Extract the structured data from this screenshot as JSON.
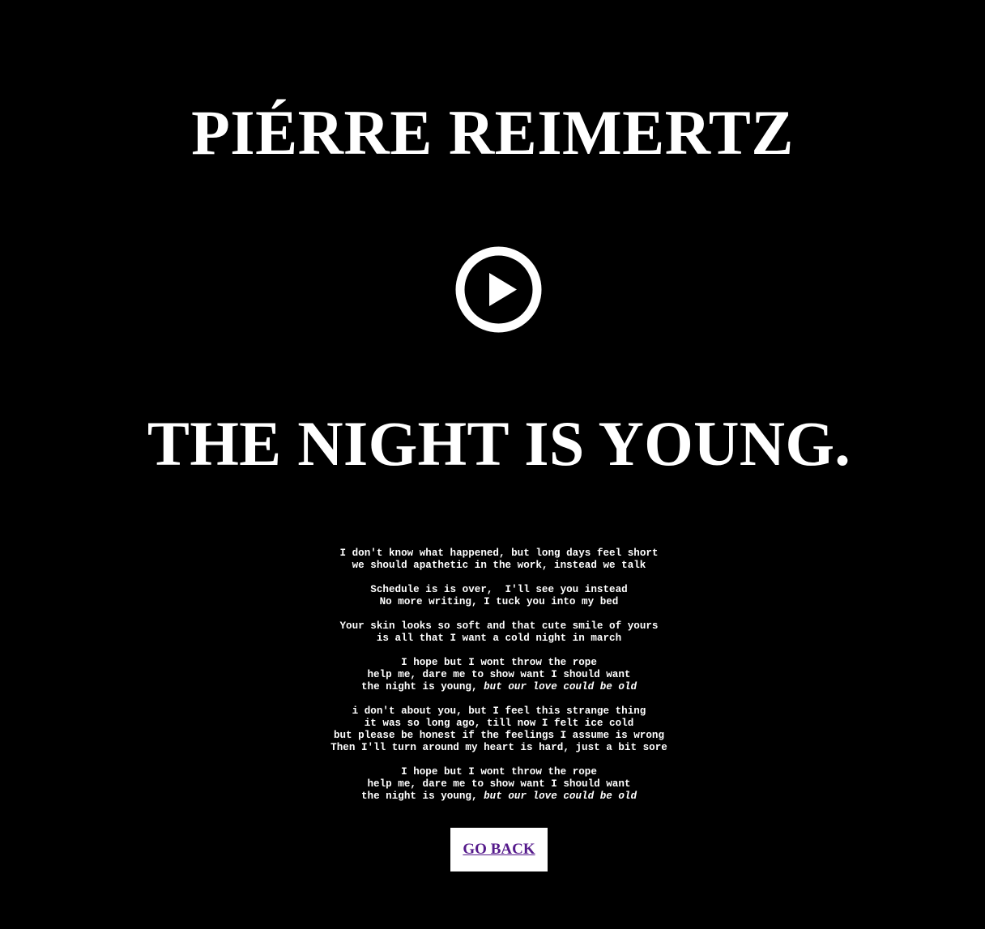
{
  "header": {
    "artist": "PIÉRRE REIMERTZ"
  },
  "player": {
    "play_icon": "play-circle-icon",
    "icon_color": "#ffffff"
  },
  "song": {
    "title": "THE NIGHT IS YOUNG."
  },
  "lyrics": {
    "stanzas": [
      {
        "lines": [
          {
            "text": "I don't know what happened, but long days feel short"
          },
          {
            "text": "we should apathetic in the work, instead we talk"
          }
        ]
      },
      {
        "lines": [
          {
            "text": "Schedule is is over,  I'll see you instead"
          },
          {
            "text": "No more writing, I tuck you into my bed"
          }
        ]
      },
      {
        "lines": [
          {
            "text": "Your skin looks so soft and that cute smile of yours"
          },
          {
            "text": "is all that I want a cold night in march"
          }
        ]
      },
      {
        "lines": [
          {
            "text": "I hope but I wont throw the rope"
          },
          {
            "text": "help me, dare me to show want I should want"
          },
          {
            "text": "the night is young, ",
            "italic": "but our love could be old"
          }
        ]
      },
      {
        "lines": [
          {
            "text": "i don't about you, but I feel this strange thing"
          },
          {
            "text": "it was so long ago, till now I felt ice cold"
          },
          {
            "text": "but please be honest if the feelings I assume is wrong"
          },
          {
            "text": "Then I'll turn around my heart is hard, just a bit sore"
          }
        ]
      },
      {
        "lines": [
          {
            "text": "I hope but I wont throw the rope"
          },
          {
            "text": "help me, dare me to show want I should want"
          },
          {
            "text": "the night is young, ",
            "italic": "but our love could be old"
          }
        ]
      }
    ]
  },
  "navigation": {
    "back_label": "GO BACK",
    "link_color": "#551a8b"
  }
}
